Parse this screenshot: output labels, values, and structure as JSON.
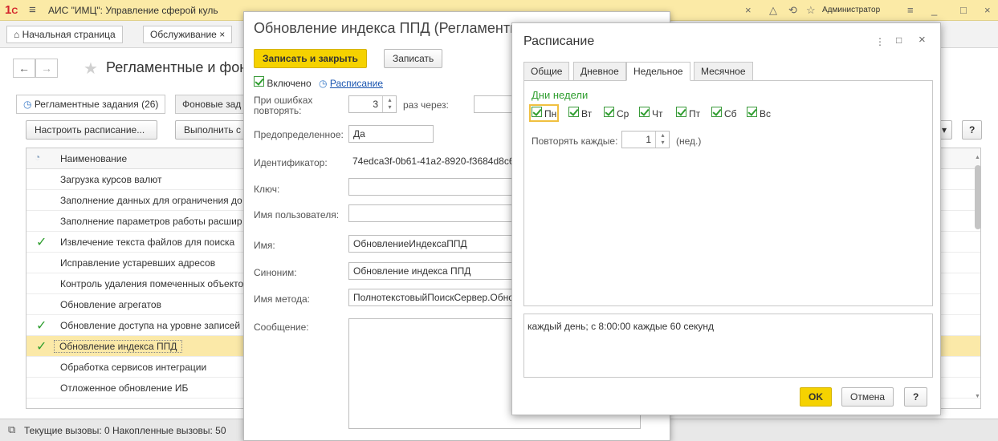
{
  "app": {
    "title": "АИС \"ИМЦ\": Управление сферой куль",
    "user": "Администратор",
    "tabs": [
      "Начальная страница",
      "Обслуживание"
    ],
    "page_title": "Регламентные и фон",
    "subtabs": [
      "Регламентные задания (26)",
      "Фоновые зад"
    ],
    "toolbar": {
      "configure": "Настроить расписание...",
      "execute": "Выполнить с",
      "help": "?"
    },
    "grid": {
      "header": "Наименование",
      "rows": [
        {
          "label": "Загрузка курсов валют",
          "checked": false
        },
        {
          "label": "Заполнение данных для ограничения до",
          "checked": false
        },
        {
          "label": "Заполнение параметров работы расшир",
          "checked": false
        },
        {
          "label": "Извлечение текста файлов для поиска",
          "checked": true
        },
        {
          "label": "Исправление устаревших адресов",
          "checked": false
        },
        {
          "label": "Контроль удаления помеченных объекто",
          "checked": false
        },
        {
          "label": "Обновление агрегатов",
          "checked": false
        },
        {
          "label": "Обновление доступа на уровне записей",
          "checked": true
        },
        {
          "label": "Обновление индекса ППД",
          "checked": true,
          "selected": true
        },
        {
          "label": "Обработка сервисов интеграции",
          "checked": false
        },
        {
          "label": "Отложенное обновление ИБ",
          "checked": false
        }
      ]
    },
    "status": "Текущие вызовы: 0   Накопленные вызовы: 50"
  },
  "dlg1": {
    "title": "Обновление индекса ППД (Регламентн",
    "save_close": "Записать и закрыть",
    "save": "Записать",
    "enabled": "Включено",
    "schedule_link": "Расписание",
    "on_errors_label": "При ошибках повторять:",
    "retry_count": "3",
    "times_via": "раз через:",
    "predefined_label": "Предопределенное:",
    "predefined_value": "Да",
    "id_label": "Идентификатор:",
    "id_value": "74edca3f-0b61-41a2-8920-f3684d8c6",
    "key_label": "Ключ:",
    "user_label": "Имя пользователя:",
    "name_label": "Имя:",
    "name_value": "ОбновлениеИндексаППД",
    "synonym_label": "Синоним:",
    "synonym_value": "Обновление индекса ППД",
    "method_label": "Имя метода:",
    "method_value": "ПолнотекстовыйПоискСервер.Обно",
    "message_label": "Сообщение:"
  },
  "dlg2": {
    "title": "Расписание",
    "tabs": [
      "Общие",
      "Дневное",
      "Недельное",
      "Месячное"
    ],
    "active_tab": 2,
    "days_heading": "Дни недели",
    "days": [
      "Пн",
      "Вт",
      "Ср",
      "Чт",
      "Пт",
      "Сб",
      "Вс"
    ],
    "repeat_label": "Повторять каждые:",
    "repeat_value": "1",
    "repeat_unit": "(нед.)",
    "summary": "каждый день; с 8:00:00 каждые 60 секунд",
    "ok": "OK",
    "cancel": "Отмена",
    "help": "?"
  }
}
